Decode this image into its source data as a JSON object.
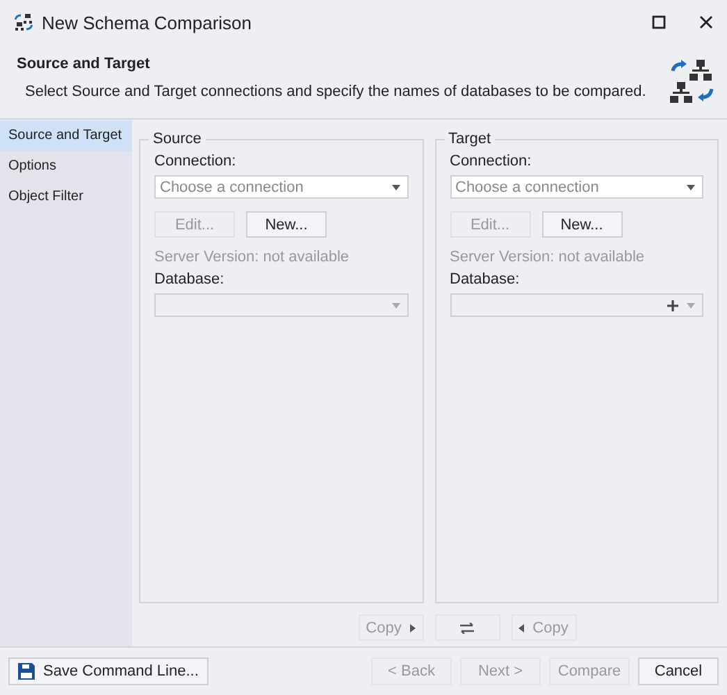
{
  "window": {
    "title": "New Schema Comparison"
  },
  "header": {
    "title": "Source and Target",
    "description": "Select Source and Target connections and specify the names of databases to be compared."
  },
  "sidebar": {
    "items": [
      {
        "label": "Source and Target",
        "selected": true
      },
      {
        "label": "Options",
        "selected": false
      },
      {
        "label": "Object Filter",
        "selected": false
      }
    ]
  },
  "panels": [
    {
      "title": "Source",
      "connection_label": "Connection:",
      "connection_placeholder": "Choose a connection",
      "edit_button": {
        "label": "Edit...",
        "disabled": true
      },
      "new_button": {
        "label": "New...",
        "disabled": false
      },
      "server_version": "Server Version: not available",
      "database_label": "Database:",
      "database_disabled": true,
      "add_database": false
    },
    {
      "title": "Target",
      "connection_label": "Connection:",
      "connection_placeholder": "Choose a connection",
      "edit_button": {
        "label": "Edit...",
        "disabled": true
      },
      "new_button": {
        "label": "New...",
        "disabled": false
      },
      "server_version": "Server Version: not available",
      "database_label": "Database:",
      "database_disabled": true,
      "add_database": true
    }
  ],
  "copy_bar": [
    {
      "kind": "copy-right",
      "label": "Copy",
      "disabled": true
    },
    {
      "kind": "swap",
      "disabled": true
    },
    {
      "kind": "copy-left",
      "label": "Copy",
      "disabled": true
    }
  ],
  "footer": {
    "save_button": {
      "label": "Save Command Line...",
      "disabled": false
    },
    "buttons": [
      {
        "label": "< Back",
        "disabled": true
      },
      {
        "label": "Next >",
        "disabled": true
      },
      {
        "label": "Compare",
        "disabled": true
      },
      {
        "label": "Cancel",
        "disabled": false
      }
    ]
  }
}
